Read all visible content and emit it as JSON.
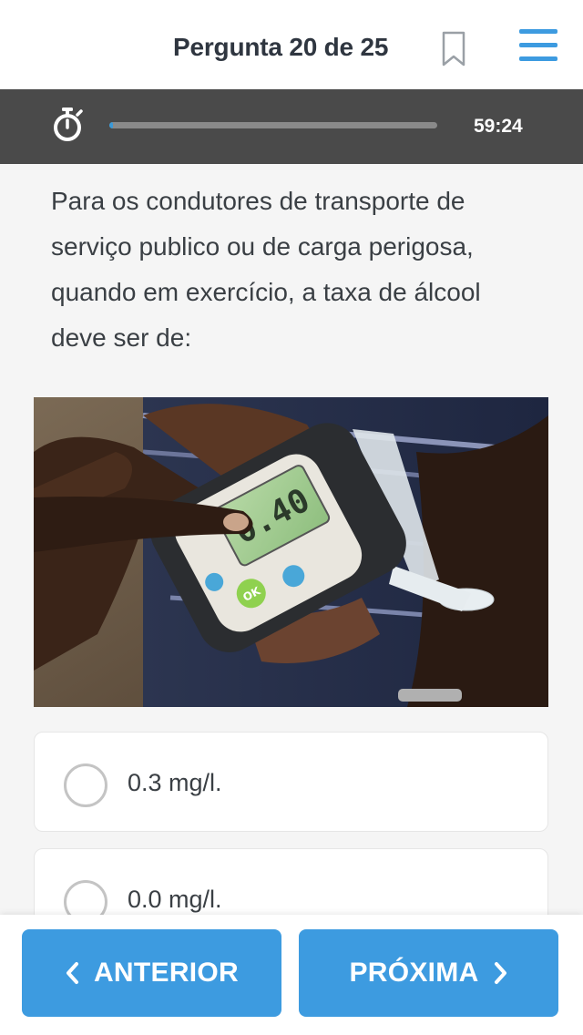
{
  "header": {
    "title": "Pergunta 20 de 25",
    "bookmark_icon": "bookmark-icon",
    "menu_icon": "hamburger-menu-icon"
  },
  "timer": {
    "icon": "stopwatch-icon",
    "time_remaining": "59:24",
    "progress_fraction": 0.01
  },
  "question": {
    "text": "Para os condutores de transporte de serviço publico ou de carga perigosa, quando em exercício, a taxa de álcool deve ser de:",
    "image_device_reading": "0.40",
    "image_device_button": "OK"
  },
  "options": [
    {
      "label": "0.3 mg/l.",
      "selected": false
    },
    {
      "label": "0.0 mg/l.",
      "selected": false
    }
  ],
  "navigation": {
    "prev_label": "ANTERIOR",
    "next_label": "PRÓXIMA",
    "prev_icon": "chevron-left-icon",
    "next_icon": "chevron-right-icon"
  },
  "colors": {
    "accent": "#3d9be0",
    "timer_bar": "#4a4a4a",
    "title_text": "#2f3640"
  }
}
